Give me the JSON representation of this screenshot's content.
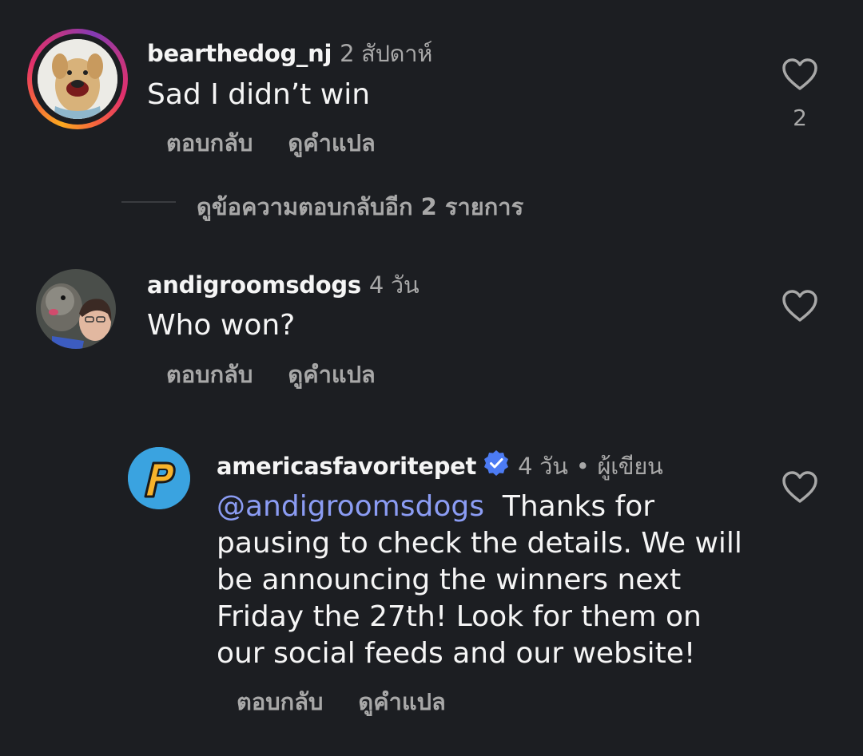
{
  "comments": [
    {
      "username": "bearthedog_nj",
      "time": "2 สัปดาห์",
      "text": "Sad I didn’t win",
      "reply": "ตอบกลับ",
      "translate": "ดูคำแปล",
      "likes": "2",
      "view_replies": "ดูข้อความตอบกลับอีก 2 รายการ"
    },
    {
      "username": "andigroomsdogs",
      "time": "4 วัน",
      "text": "Who won?",
      "reply": "ตอบกลับ",
      "translate": "ดูคำแปล"
    },
    {
      "username": "americasfavoritepet",
      "time": "4 วัน",
      "separator": "•",
      "author_tag": "ผู้เขียน",
      "mention": "@andigroomsdogs",
      "text": "Thanks for pausing to check the details. We will be announcing the winners next Friday the 27th! Look for them on our social feeds and our website!",
      "reply": "ตอบกลับ",
      "translate": "ดูคำแปล",
      "avatar_letter": "P"
    }
  ],
  "colors": {
    "background": "#1c1e22",
    "secondary_text": "#a8a8a8",
    "mention": "#8b9cf3",
    "verified": "#4c7bf3"
  },
  "icons": [
    "heart-icon",
    "verified-badge-icon"
  ]
}
